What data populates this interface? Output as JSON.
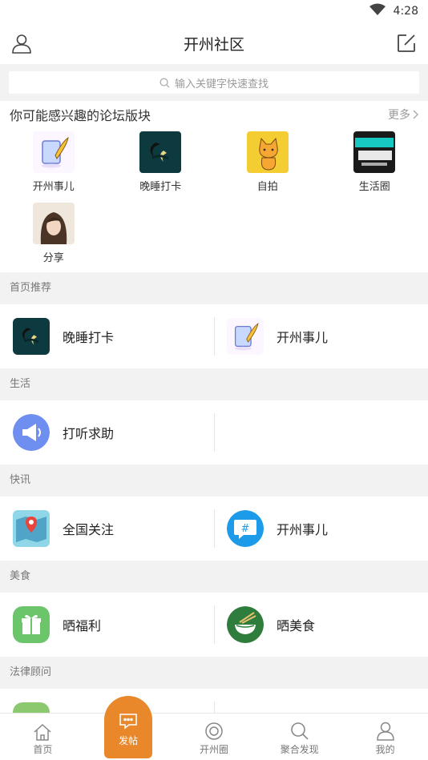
{
  "status": {
    "time": "4:28"
  },
  "header": {
    "title": "开州社区"
  },
  "search": {
    "placeholder": "输入关键字快速查找"
  },
  "interest": {
    "title": "你可能感兴趣的论坛版块",
    "more": "更多",
    "forums": [
      {
        "label": "开州事儿",
        "icon": "feather-tablet-icon"
      },
      {
        "label": "晚睡打卡",
        "icon": "crescent-moon-icon"
      },
      {
        "label": "自拍",
        "icon": "cat-icon"
      },
      {
        "label": "生活圈",
        "icon": "happiness-poster-icon"
      },
      {
        "label": "分享",
        "icon": "portrait-photo-icon"
      }
    ]
  },
  "sections": [
    {
      "title": "首页推荐",
      "items": [
        {
          "label": "晚睡打卡",
          "icon": "crescent-moon-icon"
        },
        {
          "label": "开州事儿",
          "icon": "feather-tablet-icon"
        }
      ]
    },
    {
      "title": "生活",
      "items": [
        {
          "label": "打听求助",
          "icon": "megaphone-icon"
        }
      ]
    },
    {
      "title": "快讯",
      "items": [
        {
          "label": "全国关注",
          "icon": "map-pin-icon"
        },
        {
          "label": "开州事儿",
          "icon": "hashtag-chat-icon"
        }
      ]
    },
    {
      "title": "美食",
      "items": [
        {
          "label": "晒福利",
          "icon": "gift-icon"
        },
        {
          "label": "晒美食",
          "icon": "noodle-bowl-icon"
        }
      ]
    },
    {
      "title": "法律顾问",
      "items": []
    }
  ],
  "tabs": {
    "home": "首页",
    "post": "发帖",
    "circle": "开州圈",
    "discover": "聚合发现",
    "mine": "我的"
  },
  "colors": {
    "accent": "#e8882a"
  }
}
